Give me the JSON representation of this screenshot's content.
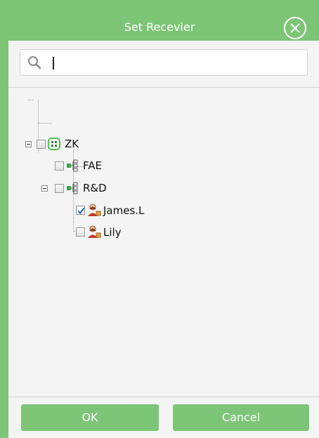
{
  "dialog": {
    "title": "Set Recevier",
    "close_icon": "close-circle-icon"
  },
  "search": {
    "icon": "search-icon",
    "value": "",
    "placeholder": ""
  },
  "tree": {
    "root": {
      "label": "ZK",
      "icon": "company-icon",
      "checked": false,
      "expanded": true
    },
    "children": [
      {
        "label": "FAE",
        "icon": "department-icon",
        "checked": false
      },
      {
        "label": "R&D",
        "icon": "department-icon",
        "checked": false,
        "expanded": true,
        "children": [
          {
            "label": "James.L",
            "icon": "user-icon",
            "checked": true
          },
          {
            "label": "Lily",
            "icon": "user-icon",
            "checked": false
          }
        ]
      }
    ]
  },
  "buttons": {
    "ok_label": "OK",
    "cancel_label": "Cancel"
  },
  "colors": {
    "accent": "#7cc576",
    "panel": "#f4f4f4",
    "checkmark": "#2a5db0"
  }
}
